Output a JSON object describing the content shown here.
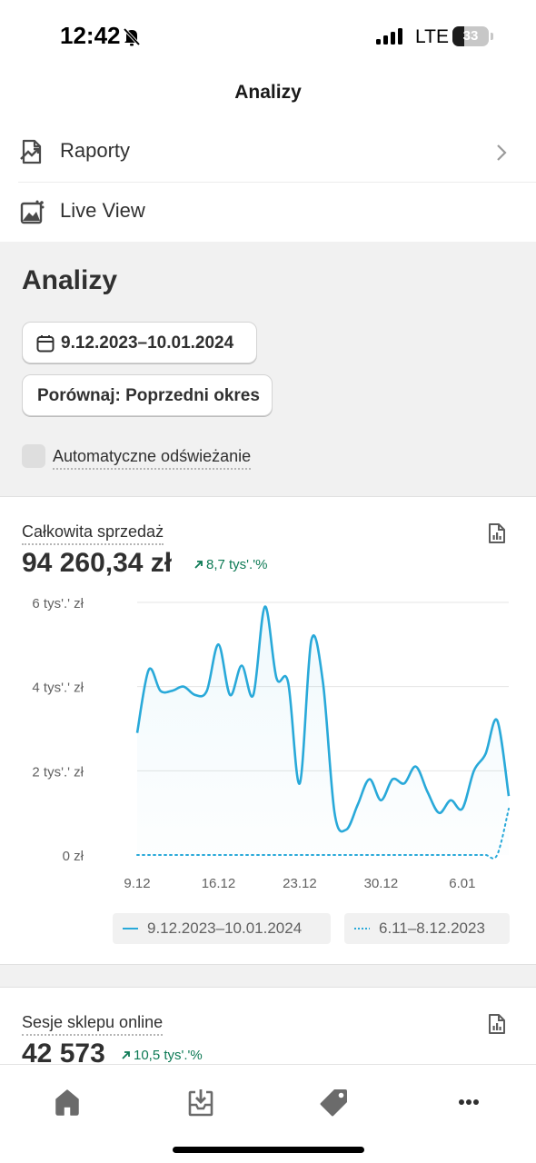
{
  "status_bar": {
    "time": "12:42",
    "network": "LTE",
    "battery": "33",
    "battery_level": 0.33
  },
  "nav": {
    "title": "Analizy"
  },
  "menu": {
    "items": [
      {
        "label": "Raporty",
        "icon": "report-chart-icon",
        "chevron": true
      },
      {
        "label": "Live View",
        "icon": "live-view-icon",
        "chevron": false
      }
    ]
  },
  "analytics": {
    "title": "Analizy",
    "date_range": "9.12.2023–10.01.2024",
    "compare": "Porównaj: Poprzedni okres",
    "auto_refresh_label": "Automatyczne odświeżanie",
    "auto_refresh_checked": false
  },
  "sales_card": {
    "title": "Całkowita sprzedaż",
    "value": "94 260,34 zł",
    "delta": "8,7 tys'.'%",
    "legend": [
      "9.12.2023–10.01.2024",
      "6.11–8.12.2023"
    ]
  },
  "sessions_card": {
    "title": "Sesje sklepu online",
    "value": "42 573",
    "delta": "10,5 tys'.'%"
  },
  "tab_bar": {
    "items": [
      "home-icon",
      "orders-icon",
      "products-tag-icon",
      "more-icon"
    ]
  },
  "colors": {
    "accent": "#29a9d9",
    "positive": "#0d7a55",
    "background": "#f1f1f1"
  },
  "chart_data": {
    "type": "line",
    "title": "Całkowita sprzedaż",
    "xlabel": "",
    "ylabel": "",
    "x": [
      "9.12",
      "10.12",
      "11.12",
      "12.12",
      "13.12",
      "14.12",
      "15.12",
      "16.12",
      "17.12",
      "18.12",
      "19.12",
      "20.12",
      "21.12",
      "22.12",
      "23.12",
      "24.12",
      "25.12",
      "26.12",
      "27.12",
      "28.12",
      "29.12",
      "30.12",
      "31.12",
      "1.01",
      "2.01",
      "3.01",
      "4.01",
      "5.01",
      "6.01",
      "7.01",
      "8.01",
      "9.01",
      "10.01"
    ],
    "x_ticks": [
      "9.12",
      "16.12",
      "23.12",
      "30.12",
      "6.01"
    ],
    "y_ticks": [
      "0 zł",
      "2 tys'.' zł",
      "4 tys'.' zł",
      "6 tys'.' zł"
    ],
    "ylim": [
      0,
      6000
    ],
    "grid": true,
    "legend_position": "bottom",
    "series": [
      {
        "name": "9.12.2023–10.01.2024",
        "style": "solid",
        "values": [
          2900,
          4400,
          3900,
          3900,
          4000,
          3800,
          3900,
          5000,
          3800,
          4500,
          3800,
          5900,
          4200,
          4100,
          1700,
          5100,
          4100,
          1000,
          600,
          1200,
          1800,
          1300,
          1800,
          1700,
          2100,
          1500,
          1000,
          1300,
          1100,
          2000,
          2400,
          3200,
          1400
        ]
      },
      {
        "name": "6.11–8.12.2023",
        "style": "dotted",
        "values": [
          0,
          0,
          0,
          0,
          0,
          0,
          0,
          0,
          0,
          0,
          0,
          0,
          0,
          0,
          0,
          0,
          0,
          0,
          0,
          0,
          0,
          0,
          0,
          0,
          0,
          0,
          0,
          0,
          0,
          0,
          0,
          0,
          1100
        ]
      }
    ]
  }
}
